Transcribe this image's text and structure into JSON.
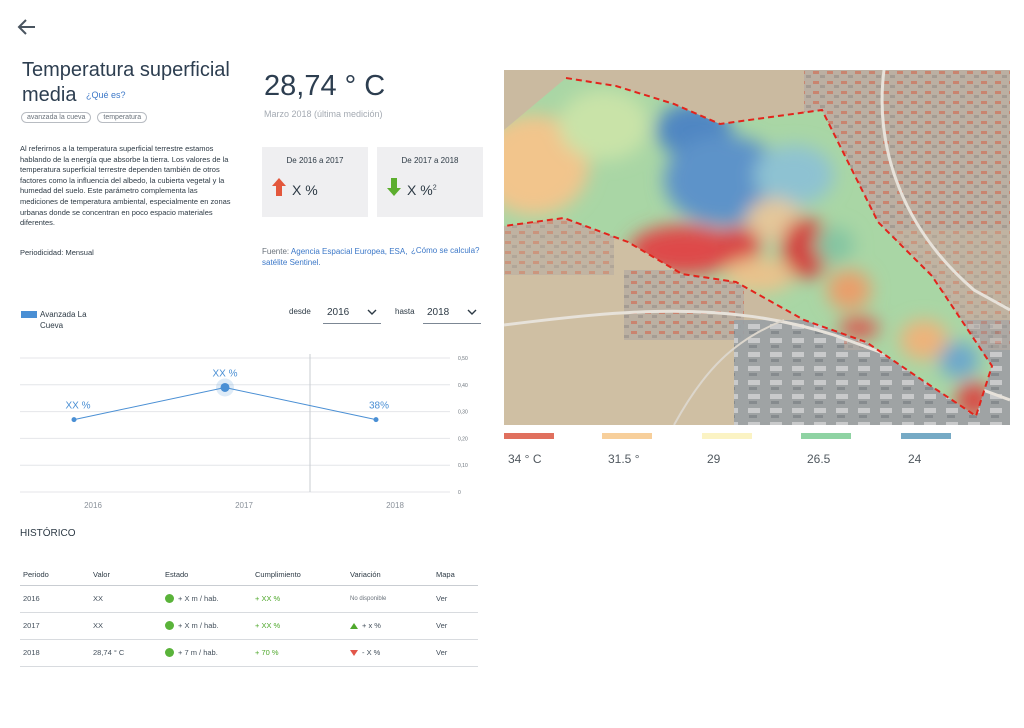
{
  "header": {
    "title": "Temperatura superficial media",
    "what_is_link": "¿Qué es?",
    "tags": [
      "avanzada la cueva",
      "temperatura"
    ],
    "description": "Al referirnos a la temperatura superficial terrestre estamos hablando de la energía que absorbe la tierra. Los valores de la temperatura superficial terrestre dependen también de otros factores como la influencia del albedo, la cubierta vegetal y la humedad del suelo. Este parámetro complementa las mediciones de temperatura ambiental, especialmente en zonas urbanas donde se concentran en poco espacio materiales diferentes.",
    "periodicity": "Periodicidad: Mensual"
  },
  "current": {
    "value": "28,74 ° C",
    "subtitle": "Marzo 2018 (última medición)"
  },
  "deltas": [
    {
      "label": "De 2016 a 2017",
      "value": "X %",
      "sup": "",
      "direction": "up",
      "color": "#e3573c"
    },
    {
      "label": "De 2017 a 2018",
      "value": "X %",
      "sup": "2",
      "direction": "down",
      "color": "#5cae2e"
    }
  ],
  "source": {
    "prefix": "Fuente: ",
    "link": "Agencia Espacial Europea, ESA, satélite Sentinel.",
    "how_calc": "¿Cómo se calcula?"
  },
  "chart_controls": {
    "legend_label": "Avanzada La Cueva",
    "legend_color": "#4a8fd4",
    "from_label": "desde",
    "from_value": "2016",
    "to_label": "hasta",
    "to_value": "2018"
  },
  "chart_data": {
    "type": "line",
    "categories": [
      "2016",
      "2017",
      "2018"
    ],
    "series": [
      {
        "name": "Avanzada La Cueva",
        "values": [
          0.27,
          0.39,
          0.27
        ],
        "labels": [
          "XX %",
          "XX %",
          "38%"
        ]
      }
    ],
    "y_ticks": [
      "0,50",
      "0,40",
      "0,30",
      "0,20",
      "0,10",
      "0"
    ],
    "ylim": [
      0,
      0.5
    ],
    "highlighted_category": "2017",
    "color": "#4a8fd4"
  },
  "history": {
    "title": "HISTÓRICO",
    "columns": [
      "Periodo",
      "Valor",
      "Estado",
      "Cumplimiento",
      "Variación",
      "Mapa"
    ],
    "rows": [
      {
        "period": "2016",
        "value": "XX",
        "state": "+ X m / hab.",
        "compliance": "+ XX %",
        "variation": "No disponible",
        "variation_dir": "none",
        "map": "Ver"
      },
      {
        "period": "2017",
        "value": "XX",
        "state": "+ X m / hab.",
        "compliance": "+ XX %",
        "variation": "+ x %",
        "variation_dir": "up",
        "map": "Ver"
      },
      {
        "period": "2018",
        "value": "28,74 ° C",
        "state": "+ 7 m / hab.",
        "compliance": "+ 70 %",
        "variation": "- X %",
        "variation_dir": "down",
        "map": "Ver"
      }
    ]
  },
  "map_scale": [
    {
      "label": "34 ° C",
      "color": "#e0705e"
    },
    {
      "label": "31.5 °",
      "color": "#f7cf9b"
    },
    {
      "label": "29",
      "color": "#fbf3c4"
    },
    {
      "label": "26.5",
      "color": "#8fd3a3"
    },
    {
      "label": "24",
      "color": "#76aac5"
    }
  ]
}
